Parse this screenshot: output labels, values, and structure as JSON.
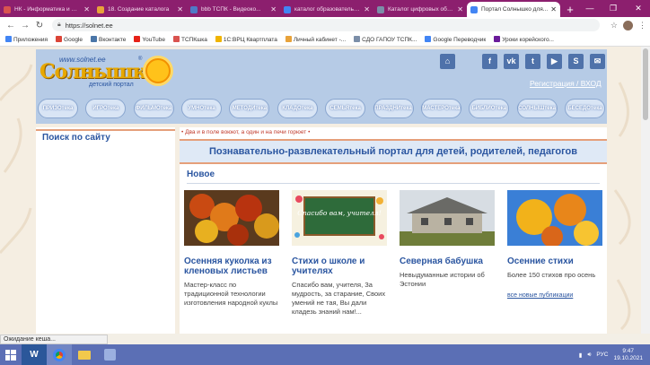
{
  "browser": {
    "tabs": [
      {
        "title": "НК - Информатика и ИКТ",
        "color": "#d9534f"
      },
      {
        "title": "18. Создание каталога",
        "color": "#e8a23a"
      },
      {
        "title": "bbb ТСПК - Видеоко...",
        "color": "#4f7ac7"
      },
      {
        "title": "каталог образовательн...",
        "color": "#4285f4"
      },
      {
        "title": "Каталог цифровых обр...",
        "color": "#7b8ea8"
      },
      {
        "title": "Портал Солнышко для...",
        "color": "#4285f4",
        "active": true
      }
    ],
    "url": "https://solnet.ee",
    "bookmarks": [
      {
        "label": "Приложения",
        "color": "#4285f4"
      },
      {
        "label": "Google",
        "color": "#db4437"
      },
      {
        "label": "Вконтакте",
        "color": "#4a76a8"
      },
      {
        "label": "YouTube",
        "color": "#e62117"
      },
      {
        "label": "ТСПКшка",
        "color": "#d9534f"
      },
      {
        "label": "1С:ВРЦ Квартплата",
        "color": "#f0b400"
      },
      {
        "label": "Личный кабинет -...",
        "color": "#e8a23a"
      },
      {
        "label": "СДО ГАПОУ ТСПК...",
        "color": "#7b8ea8"
      },
      {
        "label": "Google Переводчик",
        "color": "#4285f4"
      },
      {
        "label": "Уроки корейского...",
        "color": "#6a1b9a"
      }
    ],
    "status": "Ожидание кеша..."
  },
  "site": {
    "logo_www": "www.solnet.ee",
    "logo_name": "Солнышко",
    "logo_reg": "®",
    "logo_sub": "детский портал",
    "social_icons": [
      "map-icon",
      "facebook-icon",
      "vk-icon",
      "twitter-icon",
      "youtube-icon",
      "skype-icon",
      "mail-icon"
    ],
    "auth": "Регистрация / ВХОД",
    "menu": [
      "ПРИЗОтека",
      "ИГРОтека",
      "ФИЛЬМОтека",
      "УМНОтека",
      "МЕТОДИтека",
      "КЛАДОтека",
      "СЕМЬЯтека",
      "ПРАЗДНИтека",
      "МАСТЕРОтека",
      "БИБЛИОтека",
      "СОЛНЫШтека",
      "БЕСЕДОтека"
    ],
    "search_title": "Поиск по сайту",
    "motto": "• Два и в поле воюют, а один и на печи горюет •",
    "tagline": "Познавательно-развлекательный портал для детей, родителей, педагогов",
    "new_heading": "Новое",
    "cards": [
      {
        "title": "Осенняя куколка из кленовых листьев",
        "desc": "Мастер-класс по традиционной технологии изготовления народной куклы",
        "img": "autumn-leaves"
      },
      {
        "title": "Стихи о школе и учителях",
        "desc": "Спасибо вам, учителя, За мудрость, за старание, Своих умений не тая, Вы дали кладезь знаний нам!...",
        "img": "chalkboard",
        "img_text": "Спасибо вам, учителя!"
      },
      {
        "title": "Северная бабушка",
        "desc": "Невыдуманные истории об Эстонии",
        "img": "old-house"
      },
      {
        "title": "Осенние стихи",
        "desc": "Более 150 стихов про осень",
        "img": "yellow-leaves",
        "link": "все новые публикации"
      }
    ]
  },
  "taskbar": {
    "lang": "РУС",
    "time": "9:47",
    "date": "19.10.2021"
  }
}
